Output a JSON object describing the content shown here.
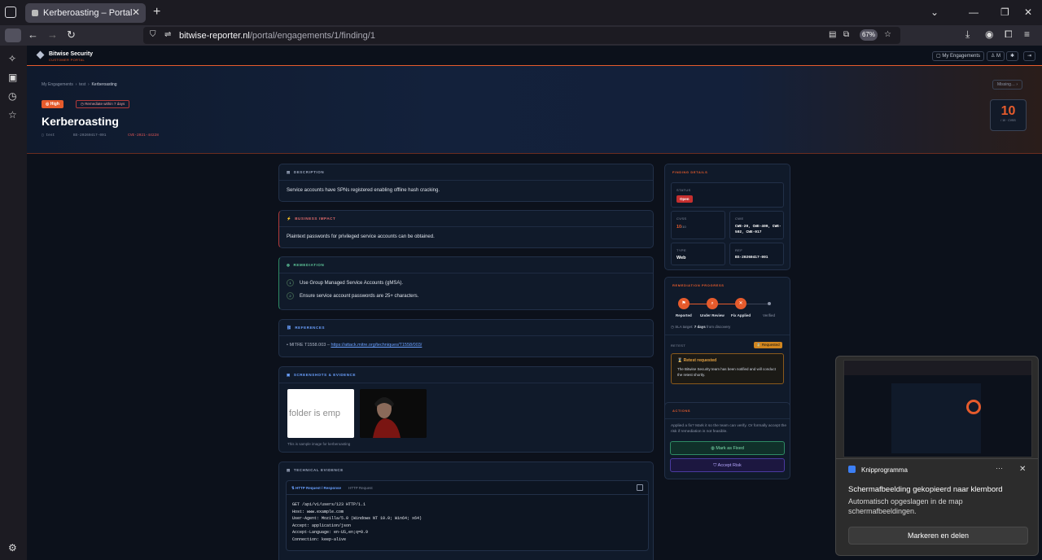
{
  "browser": {
    "tab_title": "Kerberoasting – Portal",
    "url_host": "bitwise-reporter.nl",
    "url_path": "/portal/engagements/1/finding/1",
    "zoom": "67%"
  },
  "app": {
    "brand": "Bitwise Security",
    "brand_sub": "CUSTOMER PORTAL",
    "nav_engagements": "My Engagements",
    "nav_user": "M"
  },
  "hero": {
    "breadcrumb": [
      "My Engagements",
      "test",
      "Kerberoasting"
    ],
    "missing": "Missing…",
    "severity": "High",
    "sla": "Remediate within 7 days",
    "title": "Kerberoasting",
    "meta_engagement": "test",
    "meta_ref": "BS-20260417-001",
    "meta_cve": "CVE-2021-44228",
    "score": "10",
    "score_sub": "/ 10 · CVSS"
  },
  "sections": {
    "description": {
      "title": "DESCRIPTION",
      "text": "Service accounts have SPNs registered enabling offline hash cracking."
    },
    "impact": {
      "title": "BUSINESS IMPACT",
      "text": "Plaintext passwords for privileged service accounts can be obtained."
    },
    "remediation": {
      "title": "REMEDIATION",
      "steps": [
        "Use Group Managed Service Accounts (gMSA).",
        "Ensure service account passwords are 25+ characters."
      ]
    },
    "references": {
      "title": "REFERENCES",
      "label": "MITRE T1558.003 –",
      "link": "https://attack.mitre.org/techniques/T1558/003/"
    },
    "screenshots": {
      "title": "SCREENSHOTS & EVIDENCE",
      "img_text": "folder is emp",
      "caption": "This is sample image for kerberoasting"
    },
    "technical": {
      "title": "TECHNICAL EVIDENCE",
      "http_title": "HTTP Request / Response",
      "http_sub": "HTTP Request",
      "request": "GET /api/v1/users/123 HTTP/1.1\nHost: www.example.com\nUser-Agent: Mozilla/5.0 (Windows NT 10.0; Win64; x64)\nAccept: application/json\nAccept-Language: en-US,en;q=0.9\nConnection: keep-alive"
    }
  },
  "details": {
    "title": "FINDING DETAILS",
    "status_label": "STATUS",
    "status": "Open",
    "cvss_label": "CVSS",
    "cvss": "10",
    "cvss_sub": "/10",
    "cwe_label": "CWE",
    "cwe": "CWE-20, CWE-400, CWE-502, CWE-917",
    "type_label": "TYPE",
    "type": "Web",
    "ref_label": "REF",
    "ref": "BS-20260417-001"
  },
  "progress": {
    "title": "REMEDIATION PROGRESS",
    "steps": [
      "Reported",
      "Under Review",
      "Fix Applied",
      "Verified"
    ],
    "sla_pre": "SLA target:",
    "sla_days": "7 days",
    "sla_post": "from discovery",
    "retest_label": "RETEST",
    "retest_badge": "Requested",
    "retest_title": "Retest requested",
    "retest_text": "The Bitwise Security team has been notified and will conduct the retest shortly."
  },
  "actions": {
    "title": "ACTIONS",
    "text": "Applied a fix? Mark it so the team can verify. Or formally accept the risk if remediation is not feasible.",
    "fixed": "Mark as Fixed",
    "accept": "Accept Risk"
  },
  "toast": {
    "app": "Knipprogramma",
    "title": "Schermafbeelding gekopieerd naar klembord",
    "text": "Automatisch opgeslagen in de map schermafbeeldingen.",
    "button": "Markeren en delen"
  },
  "colors": {
    "accent": "#e65b2c",
    "bg": "#0c111b",
    "card": "#101a2a",
    "danger": "#c62f2f",
    "success": "#2e8a64"
  }
}
